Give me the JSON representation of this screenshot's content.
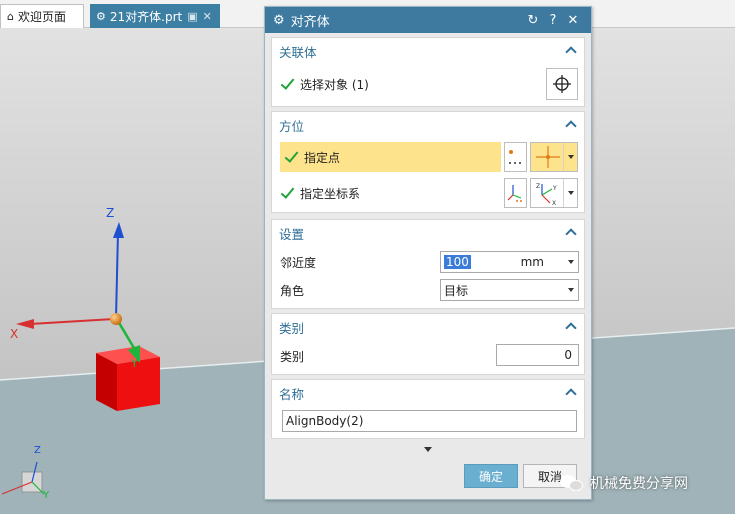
{
  "tabs": [
    {
      "label": "欢迎页面",
      "icon": "home-icon"
    },
    {
      "label": "21对齐体.prt",
      "icon": "part-icon",
      "active": true
    }
  ],
  "viewport": {
    "axis_z": "Z",
    "axis_x": "X",
    "axis_y": "Y",
    "mini_axis_z": "Z",
    "mini_axis_y": "Y"
  },
  "dialog": {
    "title": "对齐体",
    "sections": {
      "assoc": {
        "title": "关联体",
        "select_label": "选择对象 (1)"
      },
      "orient": {
        "title": "方位",
        "point_label": "指定点",
        "csys_label": "指定坐标系"
      },
      "settings": {
        "title": "设置",
        "proximity_label": "邻近度",
        "proximity_value": "100",
        "proximity_unit": "mm",
        "angle_label": "角色",
        "angle_value": "目标"
      },
      "category": {
        "title": "类别",
        "category_label": "类别",
        "category_value": "0"
      },
      "name": {
        "title": "名称",
        "name_value": "AlignBody(2)"
      }
    },
    "ok_label": "确定",
    "cancel_label": "取消"
  },
  "watermark": "机械免费分享网",
  "colors": {
    "title_bar": "#3e7aa0",
    "section_title": "#2f6f96",
    "highlight_row": "#fde38c",
    "check": "#22a23a",
    "ok_button": "#6aaed0"
  }
}
